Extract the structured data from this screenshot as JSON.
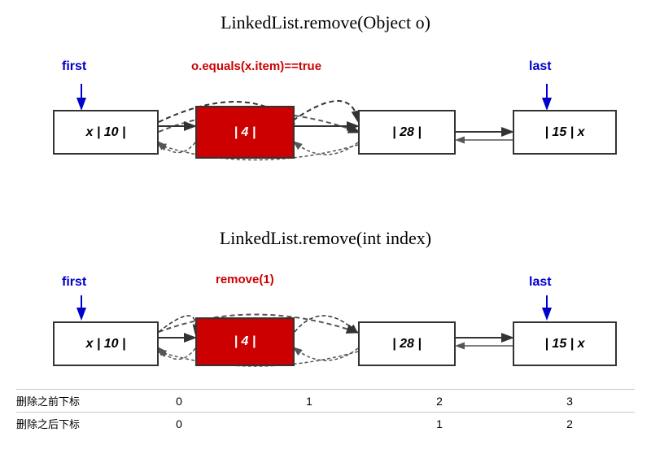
{
  "diagram1": {
    "title": "LinkedList.remove(Object o)",
    "first_label": "first",
    "last_label": "last",
    "condition": "o.equals(x.item)==true",
    "nodes": [
      {
        "id": "n1",
        "text": "x | 10 |"
      },
      {
        "id": "n2",
        "text": "| 4 |",
        "red": true
      },
      {
        "id": "n3",
        "text": "| 28 |"
      },
      {
        "id": "n4",
        "text": "| 15 | x"
      }
    ]
  },
  "diagram2": {
    "title": "LinkedList.remove(int index)",
    "first_label": "first",
    "last_label": "last",
    "condition": "remove(1)",
    "nodes": [
      {
        "id": "m1",
        "text": "x | 10 |"
      },
      {
        "id": "m2",
        "text": "| 4 |",
        "red": true
      },
      {
        "id": "m3",
        "text": "| 28 |"
      },
      {
        "id": "m4",
        "text": "| 15 | x"
      }
    ]
  },
  "table": {
    "row1_label": "删除之前下标",
    "row2_label": "删除之后下标",
    "row1_values": [
      "0",
      "1",
      "2",
      "3"
    ],
    "row2_values": [
      "0",
      "",
      "1",
      "2"
    ]
  }
}
